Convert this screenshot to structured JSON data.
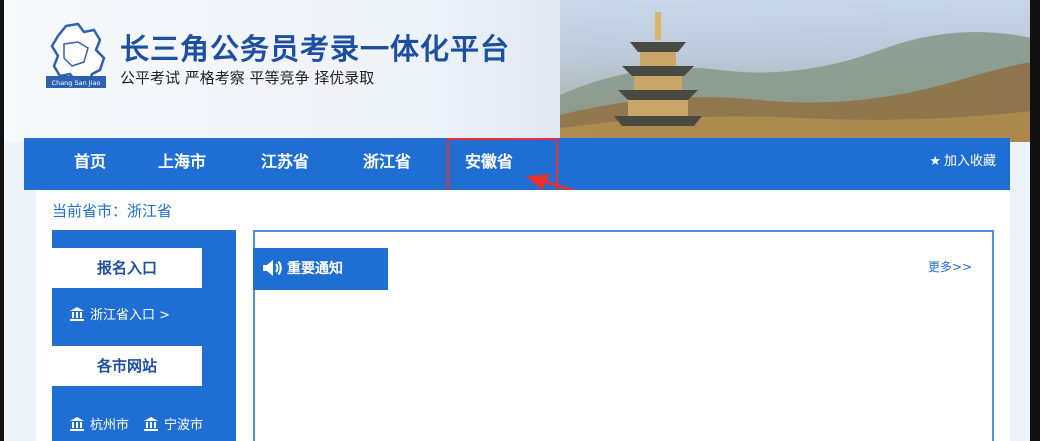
{
  "header": {
    "title": "长三角公务员考录一体化平台",
    "slogan": "公平考试 严格考察 平等竞争 择优录取",
    "logo_text": "Chang San Jiao"
  },
  "nav": {
    "items": [
      "首页",
      "上海市",
      "江苏省",
      "浙江省",
      "安徽省"
    ],
    "favorite": "加入收藏"
  },
  "breadcrumb": "当前省市：浙江省",
  "sidebar": {
    "register_heading": "报名入口",
    "zhejiang_entry": "浙江省入口 >",
    "city_heading": "各市网站",
    "cities": [
      "杭州市",
      "宁波市"
    ]
  },
  "notice": {
    "tab_label": "重要通知",
    "more_link": "更多>>"
  },
  "colors": {
    "primary": "#1f6ed4",
    "title": "#1e4fa0",
    "highlight": "#e8312d"
  }
}
